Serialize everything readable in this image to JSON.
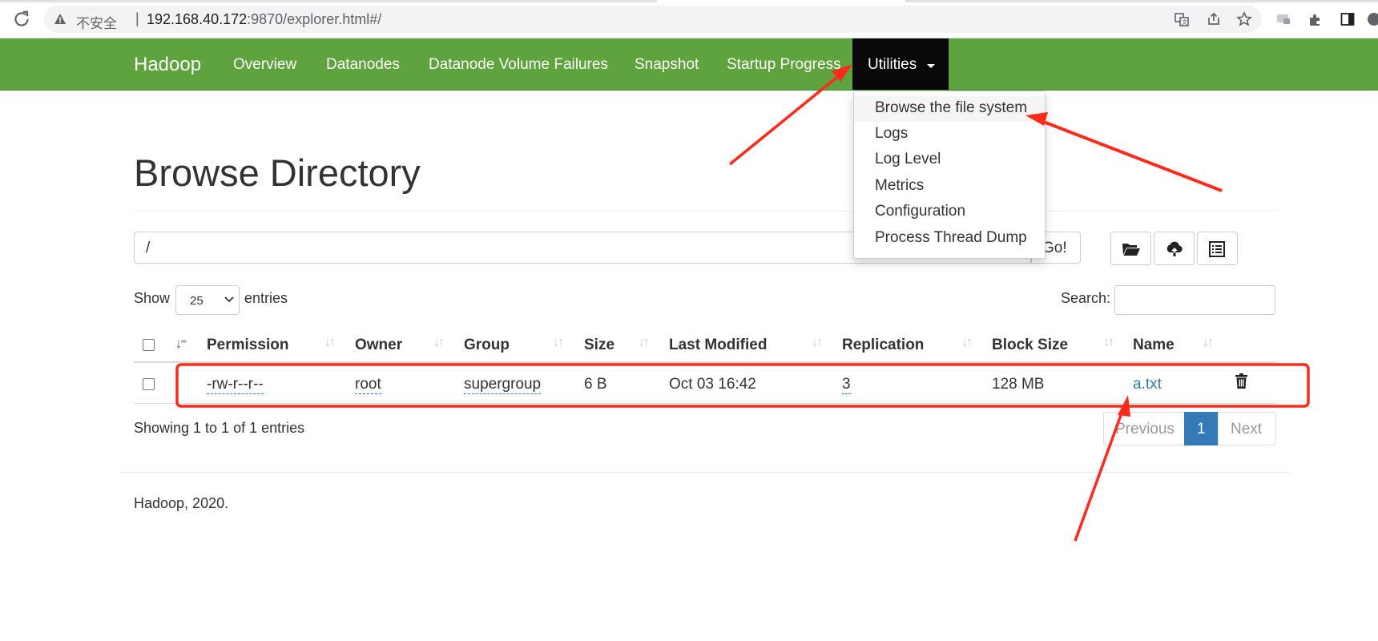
{
  "browser": {
    "insecure_label": "不安全",
    "separator": "|",
    "url_host": "192.168.40.172",
    "url_rest": ":9870/explorer.html#/"
  },
  "navbar": {
    "brand": "Hadoop",
    "items": [
      {
        "label": "Overview"
      },
      {
        "label": "Datanodes"
      },
      {
        "label": "Datanode Volume Failures"
      },
      {
        "label": "Snapshot"
      },
      {
        "label": "Startup Progress"
      }
    ],
    "active_item": "Utilities"
  },
  "dropdown": {
    "items": [
      {
        "label": "Browse the file system"
      },
      {
        "label": "Logs"
      },
      {
        "label": "Log Level"
      },
      {
        "label": "Metrics"
      },
      {
        "label": "Configuration"
      },
      {
        "label": "Process Thread Dump"
      }
    ]
  },
  "page": {
    "title": "Browse Directory",
    "path_value": "/",
    "go_label": "Go!",
    "show_label": "Show",
    "entries_value": "25",
    "entries_label": "entries",
    "search_label": "Search:"
  },
  "table": {
    "headers": [
      "Permission",
      "Owner",
      "Group",
      "Size",
      "Last Modified",
      "Replication",
      "Block Size",
      "Name"
    ],
    "rows": [
      {
        "permission": "-rw-r--r--",
        "owner": "root",
        "group": "supergroup",
        "size": "6 B",
        "modified": "Oct 03 16:42",
        "replication": "3",
        "block_size": "128 MB",
        "name": "a.txt"
      }
    ]
  },
  "pagination": {
    "info": "Showing 1 to 1 of 1 entries",
    "previous": "Previous",
    "current": "1",
    "next": "Next"
  },
  "footer": {
    "text": "Hadoop, 2020."
  },
  "colors": {
    "navbar": "#5fa33e",
    "active_nav": "#080808",
    "link": "#337ab7",
    "annotation": "#ff2a1a"
  }
}
